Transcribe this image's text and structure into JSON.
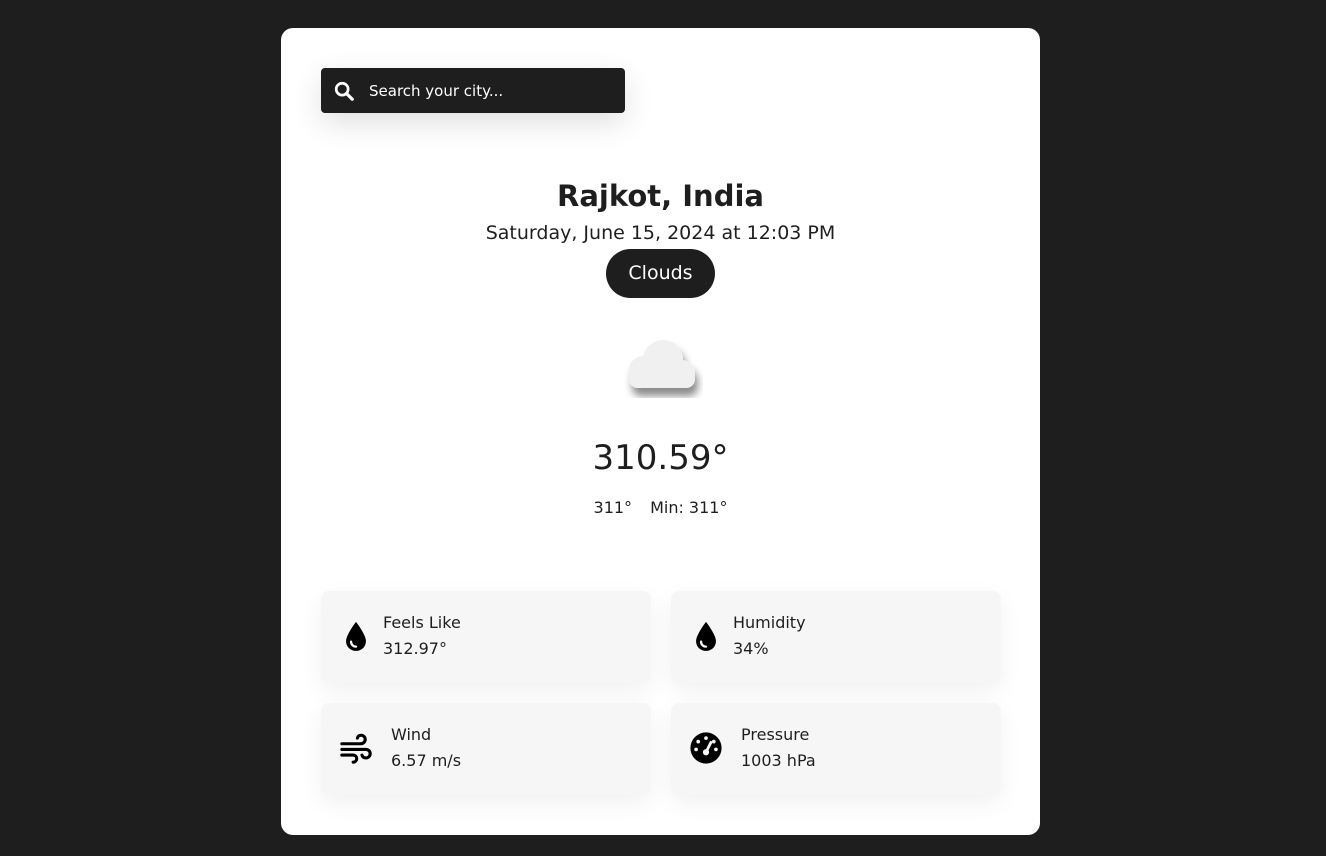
{
  "search": {
    "placeholder": "Search your city..."
  },
  "location": {
    "city": "Rajkot, India",
    "datetime": "Saturday, June 15, 2024 at 12:03 PM"
  },
  "weather": {
    "condition": "Clouds",
    "icon": "cloud-icon",
    "temperature": "310.59°",
    "max": "311°",
    "min": "Min: 311°"
  },
  "stats": {
    "feels_like": {
      "label": "Feels Like",
      "value": "312.97°",
      "icon": "droplet-icon"
    },
    "humidity": {
      "label": "Humidity",
      "value": "34%",
      "icon": "droplet-icon"
    },
    "wind": {
      "label": "Wind",
      "value": "6.57 m/s",
      "icon": "wind-icon"
    },
    "pressure": {
      "label": "Pressure",
      "value": "1003 hPa",
      "icon": "gauge-icon"
    }
  },
  "colors": {
    "background": "#1e1e1e",
    "card": "#ffffff",
    "stat_card": "#f6f6f6"
  }
}
